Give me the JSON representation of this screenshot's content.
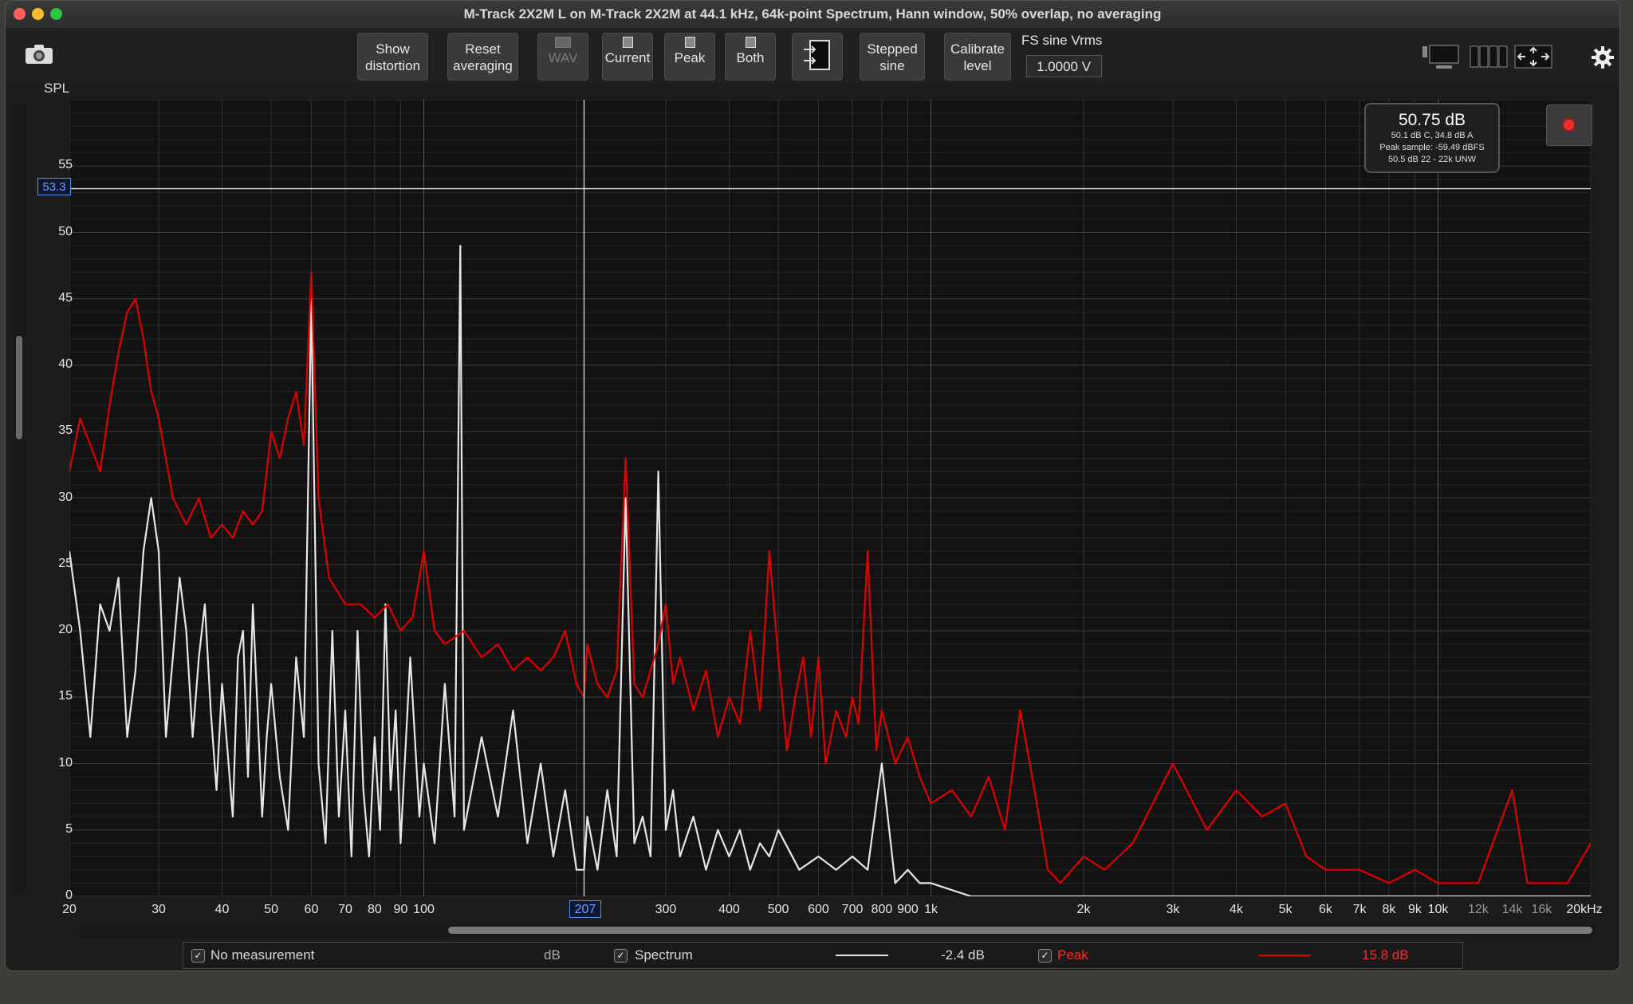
{
  "window": {
    "title": "M-Track 2X2M  L on M-Track 2X2M at 44.1 kHz, 64k-point Spectrum, Hann window, 50% overlap, no averaging"
  },
  "toolbar": {
    "show_distortion": "Show\ndistortion",
    "reset_averaging": "Reset\naveraging",
    "wav": "WAV",
    "current": "Current",
    "peak": "Peak",
    "both": "Both",
    "stepped_sine": "Stepped\nsine",
    "calibrate_level": "Calibrate\nlevel",
    "fs_label": "FS sine Vrms",
    "fs_value": "1.0000 V"
  },
  "plot": {
    "y_label": "SPL",
    "cursor_y": "53.3",
    "cursor_x": "207"
  },
  "readout": {
    "main": "50.75 dB",
    "line1": "50.1 dB C, 34.8 dB A",
    "line2": "Peak sample: -59.49 dBFS",
    "line3": "50.5 dB 22 - 22k UNW"
  },
  "legend": {
    "no_measurement": "No measurement",
    "unit": "dB",
    "spectrum": "Spectrum",
    "spectrum_offset": "-2.4 dB",
    "peak": "Peak",
    "peak_offset": "15.8 dB",
    "spectrum_color": "#e6e6e6",
    "peak_color": "#e00000"
  },
  "chart_data": {
    "type": "line",
    "ylabel": "SPL",
    "xscale": "log",
    "xlim": [
      20,
      20000
    ],
    "ylim": [
      0,
      60
    ],
    "y_ticks": [
      0,
      5,
      10,
      15,
      20,
      25,
      30,
      35,
      40,
      45,
      50,
      55
    ],
    "x_ticks": [
      {
        "v": 20,
        "t": "20"
      },
      {
        "v": 30,
        "t": "30"
      },
      {
        "v": 40,
        "t": "40"
      },
      {
        "v": 50,
        "t": "50"
      },
      {
        "v": 60,
        "t": "60"
      },
      {
        "v": 70,
        "t": "70"
      },
      {
        "v": 80,
        "t": "80"
      },
      {
        "v": 90,
        "t": "90"
      },
      {
        "v": 100,
        "t": "100"
      },
      {
        "v": 300,
        "t": "300"
      },
      {
        "v": 400,
        "t": "400"
      },
      {
        "v": 500,
        "t": "500"
      },
      {
        "v": 600,
        "t": "600"
      },
      {
        "v": 700,
        "t": "700"
      },
      {
        "v": 800,
        "t": "800"
      },
      {
        "v": 900,
        "t": "900"
      },
      {
        "v": 1000,
        "t": "1k"
      },
      {
        "v": 2000,
        "t": "2k"
      },
      {
        "v": 3000,
        "t": "3k"
      },
      {
        "v": 4000,
        "t": "4k"
      },
      {
        "v": 5000,
        "t": "5k"
      },
      {
        "v": 6000,
        "t": "6k"
      },
      {
        "v": 7000,
        "t": "7k"
      },
      {
        "v": 8000,
        "t": "8k"
      },
      {
        "v": 9000,
        "t": "9k"
      },
      {
        "v": 10000,
        "t": "10k"
      },
      {
        "v": 12000,
        "t": "12k"
      },
      {
        "v": 14000,
        "t": "14k"
      },
      {
        "v": 16000,
        "t": "16k"
      },
      {
        "v": 20000,
        "t": "20kHz"
      }
    ],
    "cursor": {
      "x": 207,
      "y": 53.3
    },
    "series": [
      {
        "name": "Peak",
        "color": "#e00000",
        "points": [
          [
            20,
            32
          ],
          [
            21,
            36
          ],
          [
            22,
            34
          ],
          [
            23,
            32
          ],
          [
            24,
            37
          ],
          [
            25,
            41
          ],
          [
            26,
            44
          ],
          [
            27,
            45
          ],
          [
            28,
            42
          ],
          [
            29,
            38
          ],
          [
            30,
            36
          ],
          [
            32,
            30
          ],
          [
            34,
            28
          ],
          [
            36,
            30
          ],
          [
            38,
            27
          ],
          [
            40,
            28
          ],
          [
            42,
            27
          ],
          [
            44,
            29
          ],
          [
            46,
            28
          ],
          [
            48,
            29
          ],
          [
            50,
            35
          ],
          [
            52,
            33
          ],
          [
            54,
            36
          ],
          [
            56,
            38
          ],
          [
            58,
            34
          ],
          [
            60,
            47
          ],
          [
            62,
            30
          ],
          [
            65,
            24
          ],
          [
            70,
            22
          ],
          [
            75,
            22
          ],
          [
            80,
            21
          ],
          [
            85,
            22
          ],
          [
            90,
            20
          ],
          [
            95,
            21
          ],
          [
            100,
            26
          ],
          [
            105,
            20
          ],
          [
            110,
            19
          ],
          [
            120,
            20
          ],
          [
            130,
            18
          ],
          [
            140,
            19
          ],
          [
            150,
            17
          ],
          [
            160,
            18
          ],
          [
            170,
            17
          ],
          [
            180,
            18
          ],
          [
            190,
            20
          ],
          [
            200,
            16
          ],
          [
            207,
            15
          ],
          [
            210,
            19
          ],
          [
            220,
            16
          ],
          [
            230,
            15
          ],
          [
            240,
            17
          ],
          [
            250,
            33
          ],
          [
            260,
            16
          ],
          [
            270,
            15
          ],
          [
            280,
            17
          ],
          [
            290,
            19
          ],
          [
            300,
            22
          ],
          [
            310,
            16
          ],
          [
            320,
            18
          ],
          [
            340,
            14
          ],
          [
            360,
            17
          ],
          [
            380,
            12
          ],
          [
            400,
            15
          ],
          [
            420,
            13
          ],
          [
            440,
            20
          ],
          [
            460,
            14
          ],
          [
            480,
            26
          ],
          [
            500,
            18
          ],
          [
            520,
            11
          ],
          [
            540,
            15
          ],
          [
            560,
            18
          ],
          [
            580,
            12
          ],
          [
            600,
            18
          ],
          [
            620,
            10
          ],
          [
            650,
            14
          ],
          [
            680,
            12
          ],
          [
            700,
            15
          ],
          [
            720,
            13
          ],
          [
            750,
            26
          ],
          [
            780,
            11
          ],
          [
            800,
            14
          ],
          [
            850,
            10
          ],
          [
            900,
            12
          ],
          [
            950,
            9
          ],
          [
            1000,
            7
          ],
          [
            1100,
            8
          ],
          [
            1200,
            6
          ],
          [
            1300,
            9
          ],
          [
            1400,
            5
          ],
          [
            1500,
            14
          ],
          [
            1600,
            8
          ],
          [
            1700,
            2
          ],
          [
            1800,
            1
          ],
          [
            2000,
            3
          ],
          [
            2200,
            2
          ],
          [
            2500,
            4
          ],
          [
            3000,
            10
          ],
          [
            3500,
            5
          ],
          [
            4000,
            8
          ],
          [
            4500,
            6
          ],
          [
            5000,
            7
          ],
          [
            5500,
            3
          ],
          [
            6000,
            2
          ],
          [
            7000,
            2
          ],
          [
            8000,
            1
          ],
          [
            9000,
            2
          ],
          [
            10000,
            1
          ],
          [
            12000,
            1
          ],
          [
            14000,
            8
          ],
          [
            15000,
            1
          ],
          [
            16000,
            1
          ],
          [
            18000,
            1
          ],
          [
            20000,
            4
          ]
        ]
      },
      {
        "name": "Spectrum",
        "color": "#e6e6e6",
        "points": [
          [
            20,
            26
          ],
          [
            21,
            20
          ],
          [
            22,
            12
          ],
          [
            23,
            22
          ],
          [
            24,
            20
          ],
          [
            25,
            24
          ],
          [
            26,
            12
          ],
          [
            27,
            17
          ],
          [
            28,
            26
          ],
          [
            29,
            30
          ],
          [
            30,
            26
          ],
          [
            31,
            12
          ],
          [
            32,
            18
          ],
          [
            33,
            24
          ],
          [
            34,
            20
          ],
          [
            35,
            12
          ],
          [
            36,
            18
          ],
          [
            37,
            22
          ],
          [
            38,
            14
          ],
          [
            39,
            8
          ],
          [
            40,
            16
          ],
          [
            41,
            11
          ],
          [
            42,
            6
          ],
          [
            43,
            18
          ],
          [
            44,
            20
          ],
          [
            45,
            9
          ],
          [
            46,
            22
          ],
          [
            47,
            14
          ],
          [
            48,
            6
          ],
          [
            49,
            12
          ],
          [
            50,
            16
          ],
          [
            52,
            9
          ],
          [
            54,
            5
          ],
          [
            56,
            18
          ],
          [
            58,
            12
          ],
          [
            60,
            45
          ],
          [
            62,
            10
          ],
          [
            64,
            4
          ],
          [
            66,
            20
          ],
          [
            68,
            6
          ],
          [
            70,
            14
          ],
          [
            72,
            3
          ],
          [
            74,
            20
          ],
          [
            76,
            8
          ],
          [
            78,
            3
          ],
          [
            80,
            12
          ],
          [
            82,
            5
          ],
          [
            84,
            22
          ],
          [
            86,
            8
          ],
          [
            88,
            14
          ],
          [
            90,
            4
          ],
          [
            94,
            18
          ],
          [
            98,
            6
          ],
          [
            100,
            10
          ],
          [
            105,
            4
          ],
          [
            110,
            16
          ],
          [
            115,
            6
          ],
          [
            118,
            49
          ],
          [
            120,
            5
          ],
          [
            130,
            12
          ],
          [
            140,
            6
          ],
          [
            150,
            14
          ],
          [
            160,
            4
          ],
          [
            170,
            10
          ],
          [
            180,
            3
          ],
          [
            190,
            8
          ],
          [
            200,
            2
          ],
          [
            207,
            2
          ],
          [
            210,
            6
          ],
          [
            220,
            2
          ],
          [
            230,
            8
          ],
          [
            240,
            3
          ],
          [
            250,
            30
          ],
          [
            260,
            4
          ],
          [
            270,
            6
          ],
          [
            280,
            3
          ],
          [
            290,
            32
          ],
          [
            300,
            5
          ],
          [
            310,
            8
          ],
          [
            320,
            3
          ],
          [
            340,
            6
          ],
          [
            360,
            2
          ],
          [
            380,
            5
          ],
          [
            400,
            3
          ],
          [
            420,
            5
          ],
          [
            440,
            2
          ],
          [
            460,
            4
          ],
          [
            480,
            3
          ],
          [
            500,
            5
          ],
          [
            550,
            2
          ],
          [
            600,
            3
          ],
          [
            650,
            2
          ],
          [
            700,
            3
          ],
          [
            750,
            2
          ],
          [
            800,
            10
          ],
          [
            850,
            1
          ],
          [
            900,
            2
          ],
          [
            950,
            1
          ],
          [
            1000,
            1
          ],
          [
            1200,
            0
          ],
          [
            1500,
            0
          ],
          [
            2000,
            0
          ],
          [
            20000,
            0
          ]
        ]
      }
    ]
  }
}
